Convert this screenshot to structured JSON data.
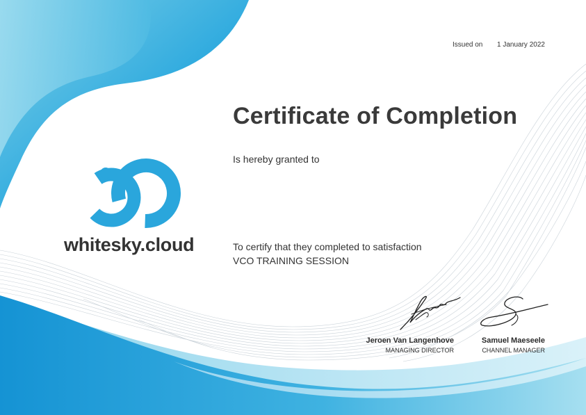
{
  "issued": {
    "label": "Issued on",
    "date": "1 January 2022"
  },
  "certificate": {
    "title": "Certificate of Completion",
    "granted_line": "Is hereby granted to",
    "certify_line": "To certify that they completed to satisfaction",
    "course": "VCO TRAINING SESSION"
  },
  "brand": {
    "name": "whitesky.cloud",
    "logo_icon": "whitesky-logo-icon",
    "color": "#2aa6dc"
  },
  "signers": [
    {
      "name": "Jeroen Van Langenhove",
      "role": "MANAGING DIRECTOR"
    },
    {
      "name": "Samuel Maeseele",
      "role": "CHANNEL MANAGER"
    }
  ],
  "colors": {
    "wave_dark": "#1a9fd8",
    "wave_light": "#8fd6ea",
    "text": "#333333"
  }
}
